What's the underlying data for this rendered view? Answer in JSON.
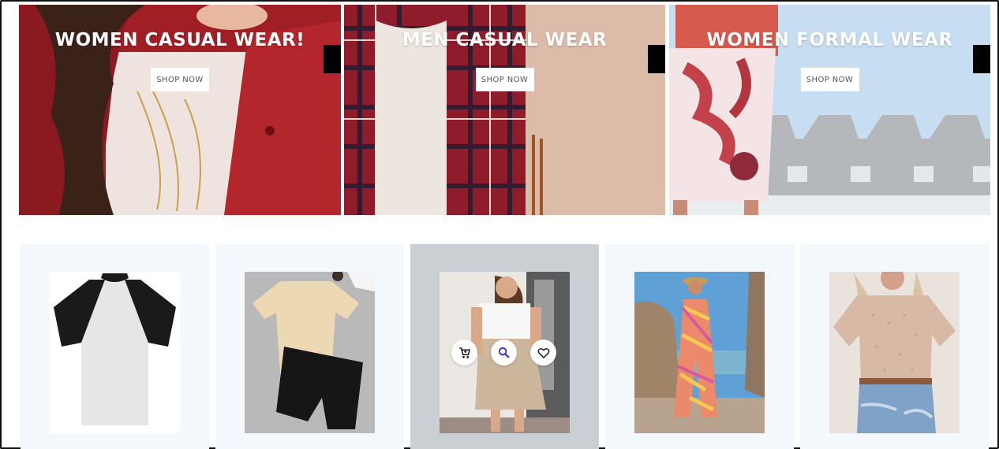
{
  "banners": [
    {
      "title": "WOMEN CASUAL WEAR!",
      "cta": "SHOP NOW"
    },
    {
      "title": "MEN CASUAL WEAR",
      "cta": "SHOP NOW"
    },
    {
      "title": "WOMEN FORMAL WEAR",
      "cta": "SHOP NOW"
    }
  ],
  "products": [
    {
      "image": "raglan-polo-shirt"
    },
    {
      "image": "tee-and-shorts-set"
    },
    {
      "image": "two-tone-dress"
    },
    {
      "image": "printed-jumpsuit"
    },
    {
      "image": "polka-dot-blouse"
    }
  ],
  "hover_actions": {
    "cart_icon": "cart-icon",
    "search_icon": "search-icon",
    "wishlist_icon": "heart-icon"
  },
  "colors": {
    "card_bg": "#f3f8fc",
    "card_hover_bg": "#c9cfd2",
    "banner_text": "#ffffff",
    "search_icon": "#2b2bd8"
  }
}
